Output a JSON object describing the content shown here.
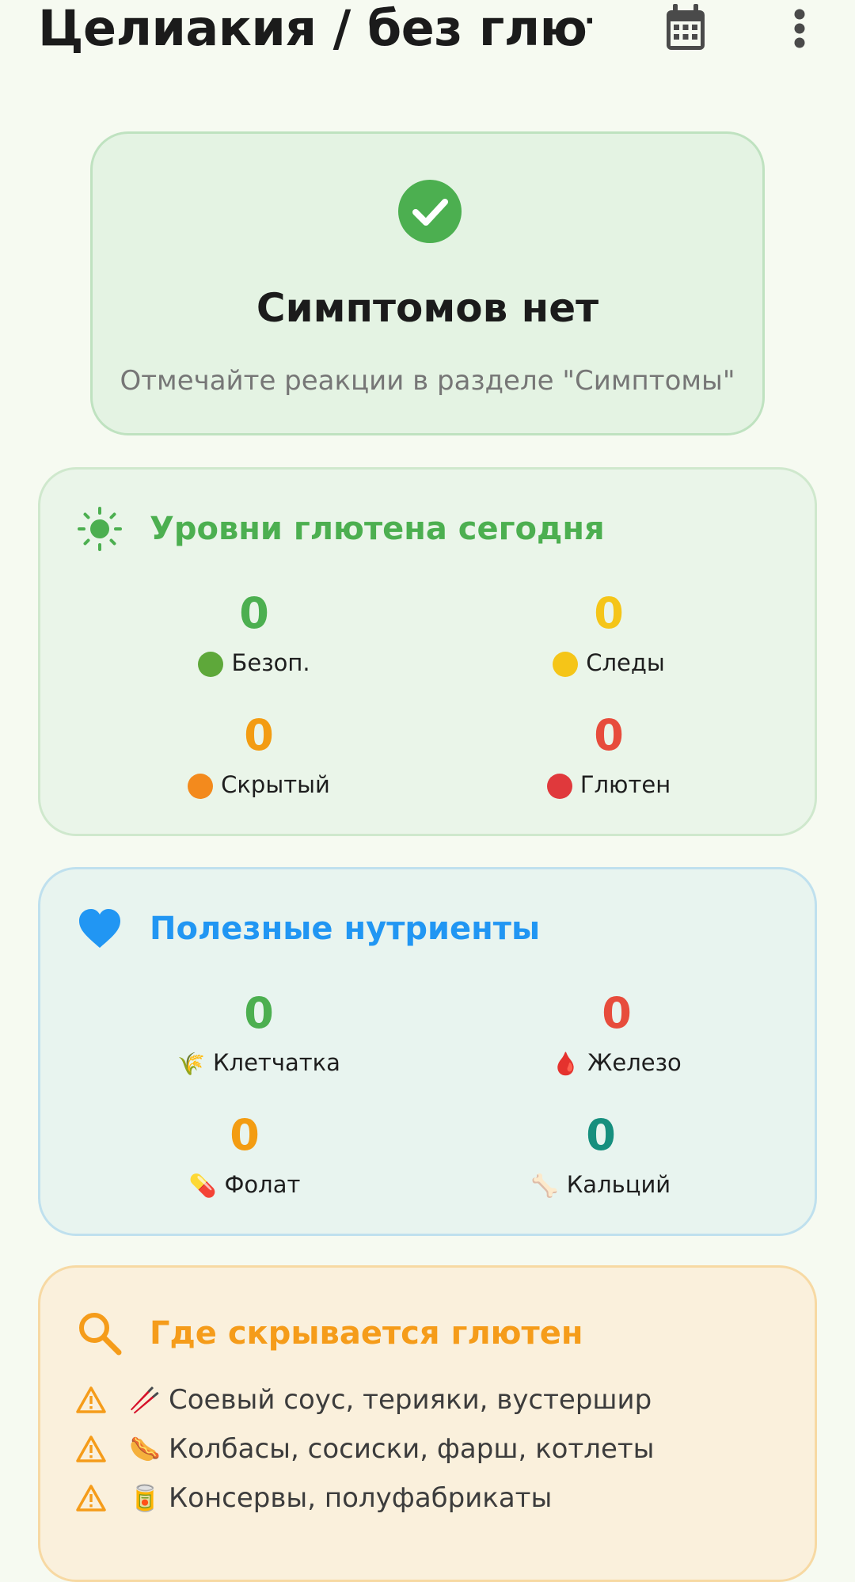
{
  "app_bar": {
    "title": "Целиакия / без глют...",
    "calendar_icon": "calendar-icon",
    "more_icon": "more-vert-icon"
  },
  "symptom_card": {
    "icon": "check-circle-icon",
    "title": "Симптомов нет",
    "subtitle": "Отмечайте реакции в разделе \"Симптомы\"",
    "accent": "#4caf50"
  },
  "gluten_card": {
    "icon": "sun-icon",
    "title": "Уровни глютена сегодня",
    "accent": "#4caf50",
    "stats": [
      {
        "value": "0",
        "label": "Безоп.",
        "indicator": "green-circle",
        "color": "#4caf50"
      },
      {
        "value": "0",
        "label": "Следы",
        "indicator": "yellow-circle",
        "color": "#f5c518"
      },
      {
        "value": "0",
        "label": "Скрытый",
        "indicator": "orange-circle",
        "color": "#f39c12"
      },
      {
        "value": "0",
        "label": "Глютен",
        "indicator": "red-circle",
        "color": "#e74c3c"
      }
    ]
  },
  "nutrients_card": {
    "icon": "heart-icon",
    "title": "Полезные нутриенты",
    "accent": "#2196f3",
    "stats": [
      {
        "value": "0",
        "label": "Клетчатка",
        "emoji": "🌾",
        "color": "#4caf50"
      },
      {
        "value": "0",
        "label": "Железо",
        "emoji": "🩸",
        "color": "#e74c3c"
      },
      {
        "value": "0",
        "label": "Фолат",
        "emoji": "💊",
        "color": "#f39c12"
      },
      {
        "value": "0",
        "label": "Кальций",
        "emoji": "🦴",
        "color": "#168f7e"
      }
    ]
  },
  "hidden_card": {
    "icon": "search-icon",
    "title": "Где скрывается глютен",
    "accent": "#f59c1a",
    "items": [
      {
        "emoji": "🥢",
        "text": "Соевый соус, терияки, вустершир"
      },
      {
        "emoji": "🌭",
        "text": "Колбасы, сосиски, фарш, котлеты"
      },
      {
        "emoji": "🥫",
        "text": "Консервы, полуфабрикаты"
      }
    ]
  }
}
